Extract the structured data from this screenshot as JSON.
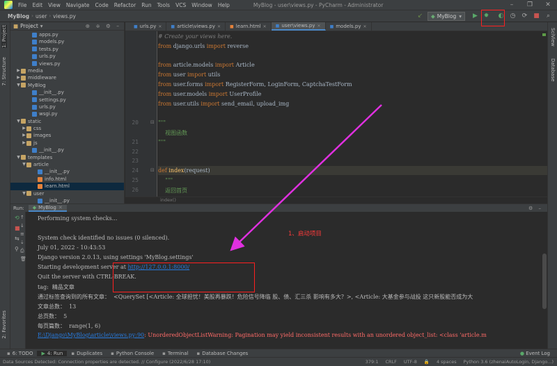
{
  "window": {
    "title": "MyBlog - user\\views.py - PyCharm - Administrator",
    "menu": [
      "File",
      "Edit",
      "View",
      "Navigate",
      "Code",
      "Refactor",
      "Run",
      "Tools",
      "VCS",
      "Window",
      "Help"
    ],
    "controls": [
      "–",
      "❐",
      "✕"
    ]
  },
  "navbar": {
    "crumbs": [
      "MyBlog",
      "user",
      "views.py"
    ],
    "run_config": "MyBlog"
  },
  "project_panel": {
    "title": "Project",
    "tree": [
      {
        "label": "apps.py",
        "type": "py",
        "indent": 3
      },
      {
        "label": "models.py",
        "type": "py",
        "indent": 3
      },
      {
        "label": "tests.py",
        "type": "py",
        "indent": 3
      },
      {
        "label": "urls.py",
        "type": "py",
        "indent": 3
      },
      {
        "label": "views.py",
        "type": "py",
        "indent": 3
      },
      {
        "label": "media",
        "type": "folder",
        "indent": 1,
        "arrow": "▶"
      },
      {
        "label": "middleware",
        "type": "folder",
        "indent": 1,
        "arrow": "▶"
      },
      {
        "label": "MyBlog",
        "type": "folder",
        "indent": 1,
        "arrow": "▼"
      },
      {
        "label": "__init__.py",
        "type": "py",
        "indent": 3
      },
      {
        "label": "settings.py",
        "type": "py",
        "indent": 3
      },
      {
        "label": "urls.py",
        "type": "py",
        "indent": 3
      },
      {
        "label": "wsgi.py",
        "type": "py",
        "indent": 3
      },
      {
        "label": "static",
        "type": "folder",
        "indent": 1,
        "arrow": "▼"
      },
      {
        "label": "css",
        "type": "folder",
        "indent": 2,
        "arrow": "▶"
      },
      {
        "label": "images",
        "type": "folder",
        "indent": 2,
        "arrow": "▶"
      },
      {
        "label": "js",
        "type": "folder",
        "indent": 2,
        "arrow": "▶"
      },
      {
        "label": "__init__.py",
        "type": "py",
        "indent": 3
      },
      {
        "label": "templates",
        "type": "folder",
        "indent": 1,
        "arrow": "▼"
      },
      {
        "label": "article",
        "type": "folder",
        "indent": 2,
        "arrow": "▼"
      },
      {
        "label": "__init__.py",
        "type": "py",
        "indent": 4
      },
      {
        "label": "info.html",
        "type": "html",
        "indent": 4
      },
      {
        "label": "learn.html",
        "type": "html",
        "indent": 4,
        "selected": true
      },
      {
        "label": "user",
        "type": "folder",
        "indent": 2,
        "arrow": "▼"
      },
      {
        "label": "__init__.py",
        "type": "py",
        "indent": 4
      }
    ]
  },
  "left_stripe": [
    "1: Project",
    "7: Structure",
    "2: Favorites"
  ],
  "right_stripe": [
    "SciView",
    "Database"
  ],
  "editor": {
    "tabs": [
      {
        "label": "urls.py",
        "active": false
      },
      {
        "label": "article\\views.py",
        "active": false
      },
      {
        "label": "learn.html",
        "active": false
      },
      {
        "label": "user\\views.py",
        "active": true
      },
      {
        "label": "models.py",
        "active": false
      }
    ],
    "line_numbers": [
      "",
      "",
      "",
      "",
      "",
      "",
      "",
      "",
      "",
      "20",
      "",
      "21",
      "22",
      "23",
      "24",
      "25",
      "26"
    ],
    "lines": [
      [
        {
          "t": "# Create your views here.",
          "c": "cmt"
        }
      ],
      [
        {
          "t": "from ",
          "c": "kw"
        },
        {
          "t": "django.urls ",
          "c": ""
        },
        {
          "t": "import ",
          "c": "kw"
        },
        {
          "t": "reverse",
          "c": ""
        }
      ],
      [],
      [
        {
          "t": "from ",
          "c": "kw"
        },
        {
          "t": "article.models ",
          "c": ""
        },
        {
          "t": "import ",
          "c": "kw"
        },
        {
          "t": "Article",
          "c": ""
        }
      ],
      [
        {
          "t": "from ",
          "c": "kw"
        },
        {
          "t": "user ",
          "c": ""
        },
        {
          "t": "import ",
          "c": "kw"
        },
        {
          "t": "utils",
          "c": ""
        }
      ],
      [
        {
          "t": "from ",
          "c": "kw"
        },
        {
          "t": "user.forms ",
          "c": ""
        },
        {
          "t": "import ",
          "c": "kw"
        },
        {
          "t": "RegisterForm, LoginForm, CaptchaTestForm",
          "c": ""
        }
      ],
      [
        {
          "t": "from ",
          "c": "kw"
        },
        {
          "t": "user.models ",
          "c": ""
        },
        {
          "t": "import ",
          "c": "kw"
        },
        {
          "t": "UserProfile",
          "c": ""
        }
      ],
      [
        {
          "t": "from ",
          "c": "kw"
        },
        {
          "t": "user.utils ",
          "c": ""
        },
        {
          "t": "import ",
          "c": "kw"
        },
        {
          "t": "send_email, upload_img",
          "c": ""
        }
      ],
      [],
      [
        {
          "t": "\"\"\"",
          "c": "doc"
        }
      ],
      [
        {
          "t": "    视图函数",
          "c": "doc"
        }
      ],
      [
        {
          "t": "\"\"\"",
          "c": "doc"
        }
      ],
      [],
      [],
      [
        {
          "t": "def ",
          "c": "kw"
        },
        {
          "t": "index",
          "c": "fn"
        },
        {
          "t": "(request)",
          "c": ""
        }
      ],
      [
        {
          "t": "    \"\"\"",
          "c": "doc"
        }
      ],
      [
        {
          "t": "    返回首页",
          "c": "doc"
        }
      ]
    ],
    "breadcrumb": "index()"
  },
  "run_panel": {
    "label": "Run:",
    "tab": "MyBlog",
    "output": [
      {
        "t": "Performing system checks...",
        "c": ""
      },
      {
        "t": "",
        "c": ""
      },
      {
        "t": "System check identified no issues (0 silenced).",
        "c": ""
      },
      {
        "t": "July 01, 2022 - 10:43:53",
        "c": ""
      },
      {
        "t": "Django version 2.0.13, using settings 'MyBlog.settings'",
        "c": ""
      },
      {
        "t": "Starting development server at ",
        "c": "",
        "link": "http://127.0.0.1:8000/"
      },
      {
        "t": "Quit the server with CTRL-BREAK.",
        "c": ""
      },
      {
        "t": "tag:  精品文章",
        "c": ""
      },
      {
        "t": "通过标签查询到的所有文章：  <QuerySet [<Article: 全球担忧！美股再暴跌！危险信号降临 股、债、汇三杀 影响有多大？>, <Article: 大基金参与战投 这只新股能否成为大",
        "c": ""
      },
      {
        "t": "文章总数：  13",
        "c": ""
      },
      {
        "t": "总页数：  5",
        "c": ""
      },
      {
        "t": "每页篇数：  range(1, 6)",
        "c": ""
      },
      {
        "t": ": UnorderedObjectListWarning: Pagination may yield inconsistent results with an unordered object_list: <class 'article.m",
        "c": "red",
        "link": "E:\\Django\\MyBlog\\article\\views.py:90"
      }
    ]
  },
  "annotation": {
    "text": "1、启动项目"
  },
  "tool_windows": [
    {
      "label": "6: TODO",
      "active": false
    },
    {
      "label": "4: Run",
      "active": true
    },
    {
      "label": "Duplicates",
      "active": false
    },
    {
      "label": "Python Console",
      "active": false
    },
    {
      "label": "Terminal",
      "active": false
    },
    {
      "label": "Database Changes",
      "active": false
    }
  ],
  "event_log": "Event Log",
  "status": {
    "message": "Data Sources Detected: Connection properties are detected. // Configure (2022/6/28 17:10)",
    "position": "379:1",
    "line_sep": "CRLF",
    "encoding": "UTF-8",
    "indent": "4 spaces",
    "interpreter": "Python 3.6 (zhenaiAutoLogin, Django...)"
  }
}
